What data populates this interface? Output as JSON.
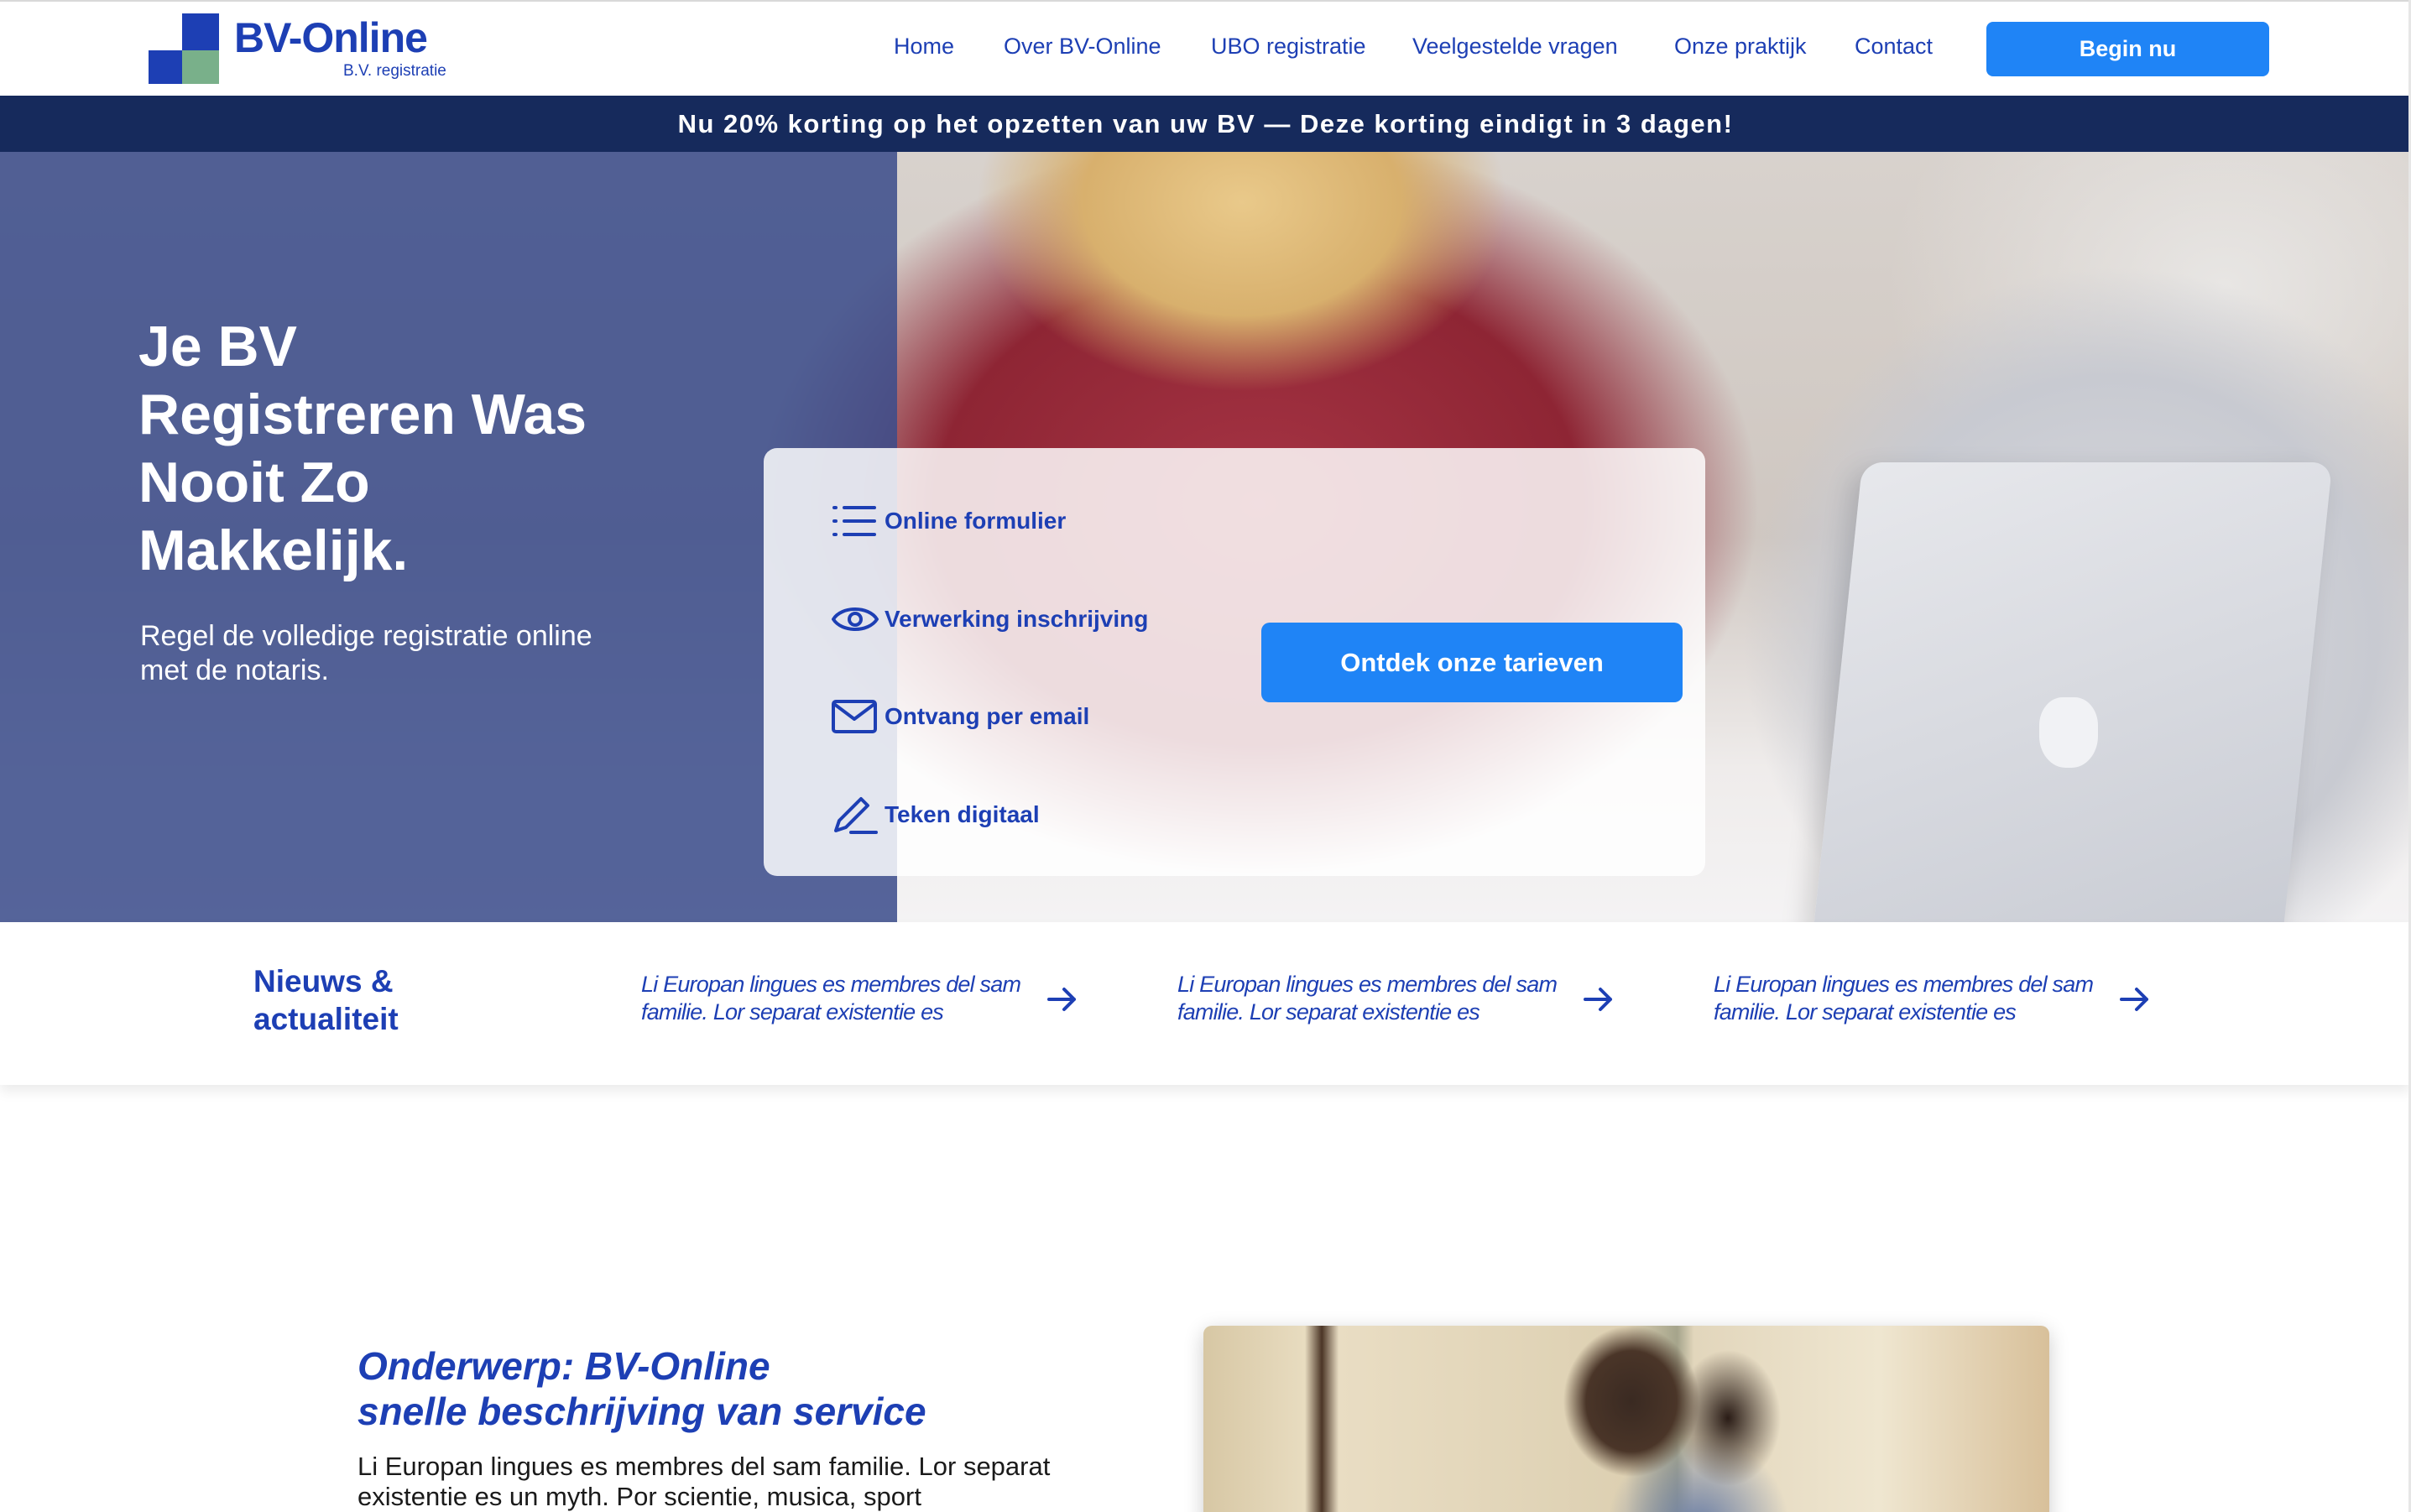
{
  "brand": {
    "name": "BV-Online",
    "tagline": "B.V. registratie",
    "colors": {
      "primary": "#1d3fb4",
      "accent": "#1f84f6",
      "promo_bg": "#162a5c",
      "logo_green": "#79b08a"
    }
  },
  "nav": {
    "items": [
      "Home",
      "Over BV-Online",
      "UBO registratie",
      "Veelgestelde vragen",
      "Onze praktijk",
      "Contact"
    ],
    "cta": "Begin nu"
  },
  "promo": {
    "text": "Nu 20% korting op het opzetten van uw BV — Deze korting eindigt in 3 dagen!"
  },
  "hero": {
    "title": "Je BV Registreren Was Nooit Zo Makkelijk.",
    "subtitle": "Regel de volledige registratie online met de notaris.",
    "features": [
      {
        "icon": "list-icon",
        "label": "Online formulier"
      },
      {
        "icon": "eye-icon",
        "label": "Verwerking inschrijving"
      },
      {
        "icon": "mail-icon",
        "label": "Ontvang per email"
      },
      {
        "icon": "pen-icon",
        "label": "Teken digitaal"
      }
    ],
    "button": "Ontdek onze tarieven"
  },
  "news": {
    "title": "Nieuws & actualiteit",
    "items": [
      "Li Europan lingues es membres del sam familie. Lor separat existentie es",
      "Li Europan lingues es membres del sam familie. Lor separat existentie es",
      "Li Europan lingues es membres del sam familie. Lor separat existentie es"
    ]
  },
  "section": {
    "heading_line1": "Onderwerp: BV-Online",
    "heading_line2": "snelle beschrijving van service",
    "body": "Li Europan lingues es membres del sam familie. Lor separat existentie es un myth. Por scientie, musica, sport"
  }
}
